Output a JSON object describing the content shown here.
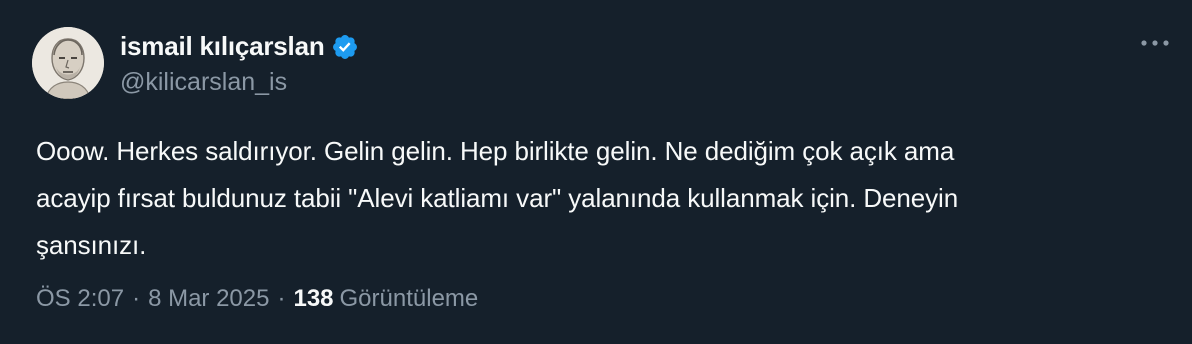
{
  "user": {
    "display_name": "ismail kılıçarslan",
    "handle": "@kilicarslan_is",
    "verified": true,
    "verified_color": "#1d9bf0"
  },
  "tweet": {
    "lines": [
      "Ooow. Herkes saldırıyor. Gelin gelin. Hep birlikte gelin. Ne dediğim çok açık ama",
      "acayip fırsat buldunuz tabii \"Alevi katliamı var\" yalanında kullanmak için. Deneyin",
      "şansınızı."
    ]
  },
  "meta": {
    "time": "ÖS 2:07",
    "separator": "·",
    "date": "8 Mar 2025",
    "views_count": "138",
    "views_label": "Görüntüleme"
  },
  "icons": {
    "more": "more-horizontal-icon",
    "verified": "verified-badge-icon"
  },
  "theme": {
    "background": "#15202b",
    "text": "#f7f9f9",
    "secondary": "#8b98a5"
  }
}
